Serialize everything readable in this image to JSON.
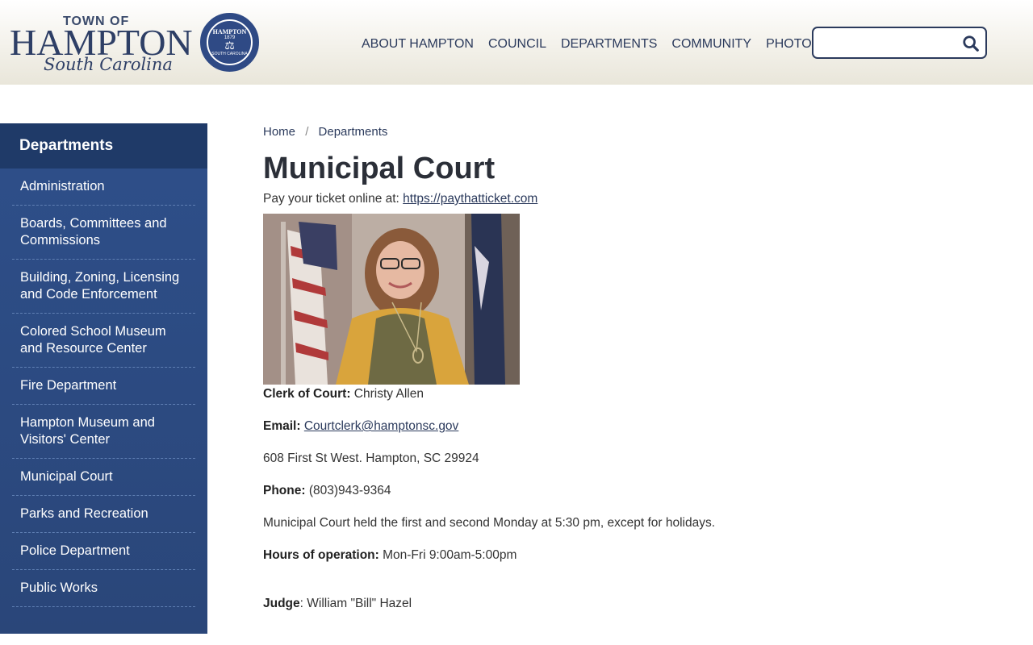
{
  "logo": {
    "town_of": "TOWN OF",
    "name": "HAMPTON",
    "state": "South Carolina",
    "seal_top": "HAMPTON",
    "seal_year": "1879",
    "seal_bottom": "SOUTH CAROLINA"
  },
  "nav": {
    "items": [
      "ABOUT HAMPTON",
      "COUNCIL",
      "DEPARTMENTS",
      "COMMUNITY",
      "PHOTOS"
    ]
  },
  "search": {
    "placeholder": ""
  },
  "sidebar": {
    "title": "Departments",
    "items": [
      "Administration",
      "Boards, Committees and Commissions",
      "Building, Zoning, Licensing and Code Enforcement",
      "Colored School Museum and Resource Center",
      "Fire Department",
      "Hampton Museum and Visitors' Center",
      "Municipal Court",
      "Parks and Recreation",
      "Police Department",
      "Public Works"
    ]
  },
  "breadcrumb": {
    "home": "Home",
    "sep": "/",
    "current": "Departments"
  },
  "main": {
    "title": "Municipal Court",
    "intro_label": "Pay your ticket online at: ",
    "intro_link": "https://paythatticket.com",
    "clerk_label": "Clerk of Court:",
    "clerk_value": " Christy Allen",
    "email_label": "Email:",
    "email_value": "Courtclerk@hamptonsc.gov",
    "address": "608 First St West. Hampton, SC 29924",
    "phone_label": "Phone:",
    "phone_value": " (803)943-9364",
    "schedule": "Municipal Court held the first and second Monday at 5:30 pm, except for holidays.",
    "hours_label": "Hours of operation:",
    "hours_value": " Mon-Fri 9:00am-5:00pm",
    "judge_label": "Judge",
    "judge_value": ": William \"Bill\" Hazel"
  },
  "colors": {
    "navy": "#2b3a5c",
    "sidebar": "#2e4f8a",
    "sidebar_title": "#1f3a68"
  }
}
